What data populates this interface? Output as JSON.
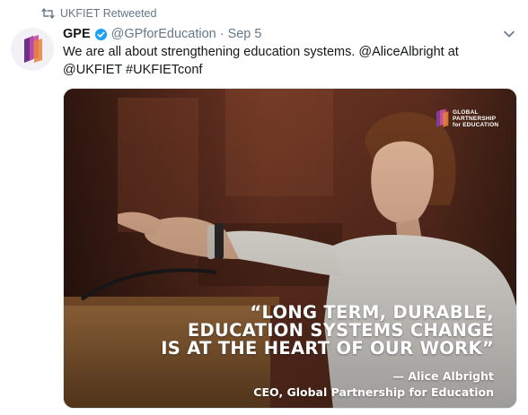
{
  "retweet": {
    "label": "UKFIET Retweeted",
    "icon": "retweet-icon"
  },
  "author": {
    "name": "GPE",
    "handle": "@GPforEducation",
    "separator": "·",
    "time": "Sep 5",
    "verified_icon": "verified-badge-icon"
  },
  "tweet": {
    "line1": "We are all about strengthening education systems. @AliceAlbright at",
    "line2": "@UKFIET #UKFIETconf"
  },
  "media": {
    "brand_lines": [
      "GLOBAL",
      "PARTNERSHIP",
      "for EDUCATION"
    ],
    "quote_lines": [
      "“LONG TERM, DURABLE,",
      "EDUCATION SYSTEMS CHANGE",
      "IS AT THE HEART OF OUR WORK”"
    ],
    "attribution_name": "— Alice Albright",
    "attribution_title": "CEO, Global Partnership for Education"
  },
  "colors": {
    "text_primary": "#14171a",
    "text_secondary": "#657786",
    "verified_blue": "#1da1f2",
    "brand_purple": "#7b3f98",
    "brand_pink": "#d0509a"
  }
}
